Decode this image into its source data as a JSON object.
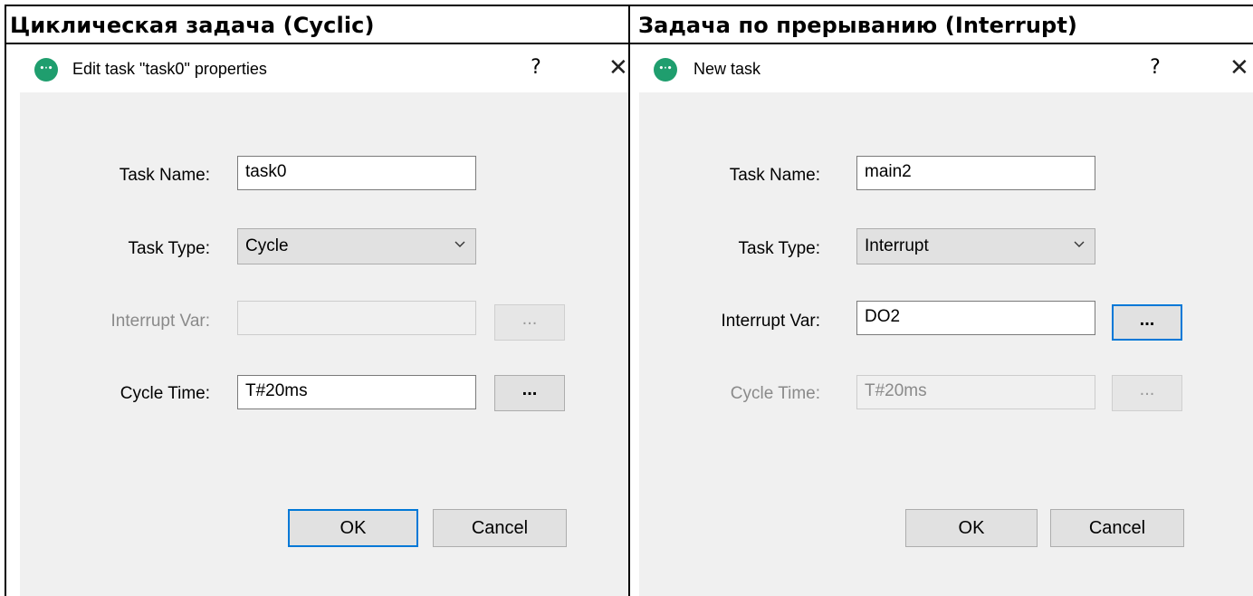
{
  "headings": {
    "left": "Циклическая задача (Cyclic)",
    "right": "Задача по прерыванию (Interrupt)"
  },
  "left_dialog": {
    "title": "Edit task \"task0\" properties",
    "help": "?",
    "close": "✕",
    "task_name_label": "Task Name:",
    "task_name_value": "task0",
    "task_type_label": "Task Type:",
    "task_type_value": "Cycle",
    "interrupt_var_label": "Interrupt Var:",
    "interrupt_var_value": "",
    "interrupt_var_browse": "...",
    "cycle_time_label": "Cycle Time:",
    "cycle_time_value": "T#20ms",
    "cycle_time_browse": "...",
    "ok": "OK",
    "cancel": "Cancel"
  },
  "right_dialog": {
    "title": "New task",
    "help": "?",
    "close": "✕",
    "task_name_label": "Task Name:",
    "task_name_value": "main2",
    "task_type_label": "Task Type:",
    "task_type_value": "Interrupt",
    "interrupt_var_label": "Interrupt Var:",
    "interrupt_var_value": "DO2",
    "interrupt_var_browse": "...",
    "cycle_time_label": "Cycle Time:",
    "cycle_time_value": "T#20ms",
    "cycle_time_browse": "...",
    "ok": "OK",
    "cancel": "Cancel"
  },
  "icons": {
    "app": "app-logo-icon",
    "dropdown": "chevron-down-icon"
  },
  "colors": {
    "accent": "#0078d7",
    "app_icon": "#1f9e6e",
    "dialog_bg": "#f0f0f0"
  }
}
